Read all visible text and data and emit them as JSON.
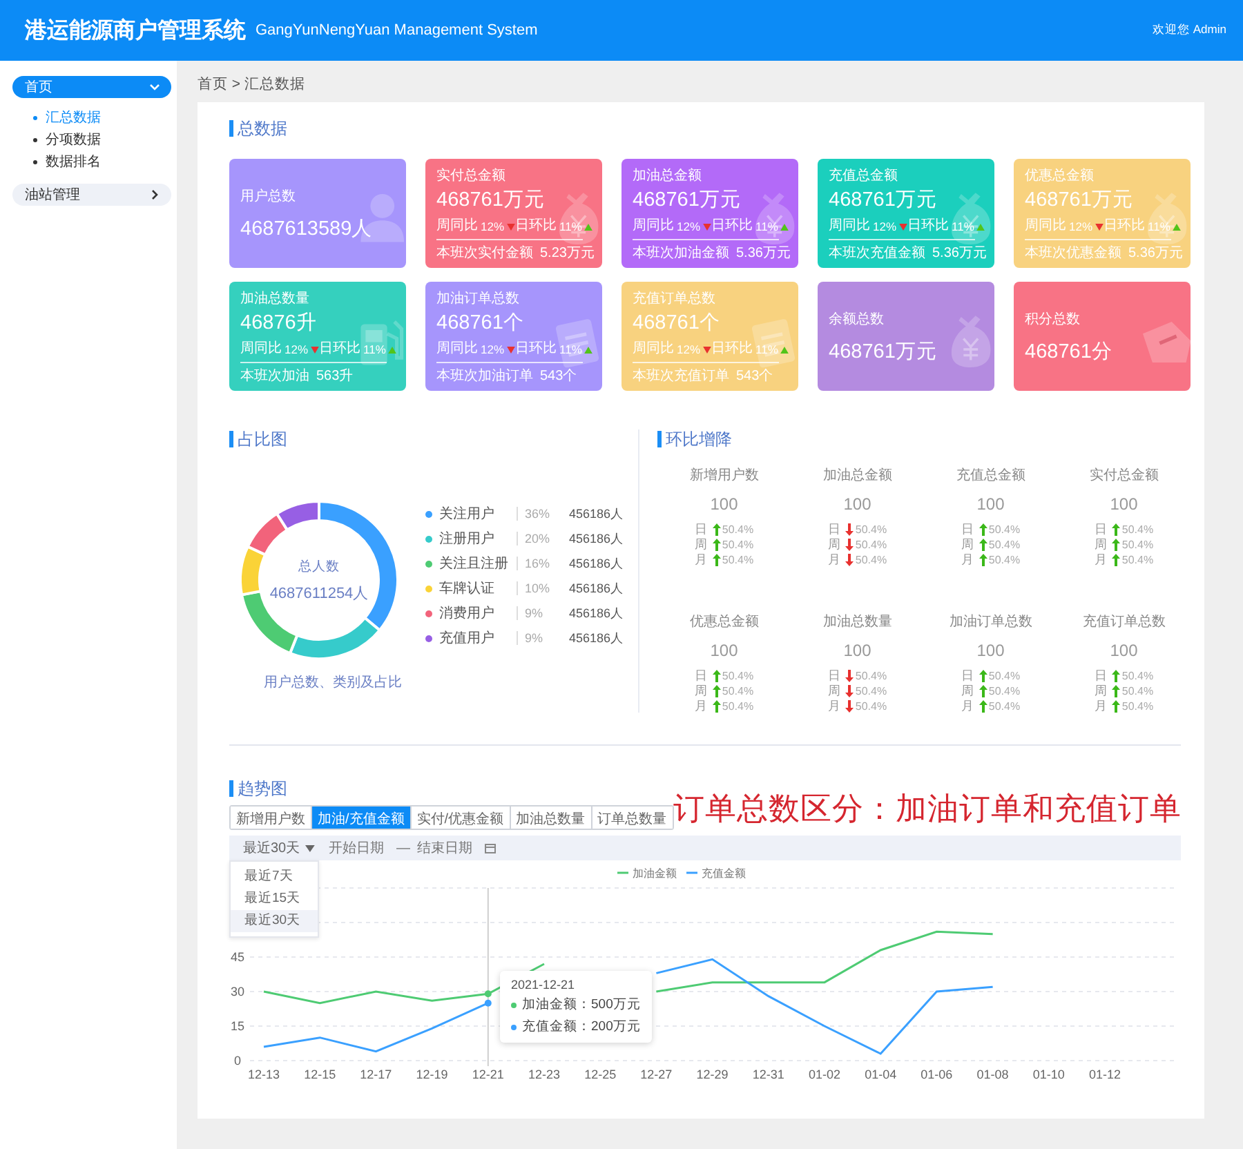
{
  "header": {
    "title": "港运能源商户管理系统",
    "subtitle": "GangYunNengYuan Management System",
    "welcome": "欢迎您 Admin"
  },
  "sidebar": {
    "items": [
      {
        "label": "首页",
        "expanded": true,
        "children": [
          {
            "label": "汇总数据",
            "selected": true
          },
          {
            "label": "分项数据",
            "selected": false
          },
          {
            "label": "数据排名",
            "selected": false
          }
        ]
      },
      {
        "label": "油站管理",
        "expanded": false
      }
    ]
  },
  "breadcrumb": "首页 > 汇总数据",
  "total_data": {
    "title": "总数据",
    "cards": [
      {
        "kind": "user",
        "title": "用户总数",
        "value": "4687613589人",
        "color": "#a695fc"
      },
      {
        "kind": "money",
        "title": "实付总金额",
        "value": "468761万元",
        "color": "#f87385",
        "stats": [
          {
            "label": "周同比",
            "value": "12%",
            "rising": false
          },
          {
            "label": "日环比",
            "value": "11%",
            "rising": true
          }
        ],
        "footer_label": "本班次实付金额",
        "footer_value": "5.23万元"
      },
      {
        "kind": "money",
        "title": "加油总金额",
        "value": "468761万元",
        "color": "#b36af8",
        "stats": [
          {
            "label": "周同比",
            "value": "12%",
            "rising": false
          },
          {
            "label": "日环比",
            "value": "11%",
            "rising": true
          }
        ],
        "footer_label": "本班次加油金额",
        "footer_value": "5.36万元"
      },
      {
        "kind": "money",
        "title": "充值总金额",
        "value": "468761万元",
        "color": "#1bcfbd",
        "stats": [
          {
            "label": "周同比",
            "value": "12%",
            "rising": false
          },
          {
            "label": "日环比",
            "value": "11%",
            "rising": true
          }
        ],
        "footer_label": "本班次充值金额",
        "footer_value": "5.36万元"
      },
      {
        "kind": "money",
        "title": "优惠总金额",
        "value": "468761万元",
        "color": "#f8d27f",
        "stats": [
          {
            "label": "周同比",
            "value": "12%",
            "rising": false
          },
          {
            "label": "日环比",
            "value": "11%",
            "rising": true
          }
        ],
        "footer_label": "本班次优惠金额",
        "footer_value": "5.36万元"
      },
      {
        "kind": "fuel",
        "title": "加油总数量",
        "value": "46876升",
        "color": "#35d0be",
        "stats": [
          {
            "label": "周同比",
            "value": "12%",
            "rising": false
          },
          {
            "label": "日环比",
            "value": "11%",
            "rising": true
          }
        ],
        "footer_label": "本班次加油",
        "footer_value": "563升"
      },
      {
        "kind": "order",
        "title": "加油订单总数",
        "value": "468761个",
        "color": "#a695fc",
        "stats": [
          {
            "label": "周同比",
            "value": "12%",
            "rising": false
          },
          {
            "label": "日环比",
            "value": "11%",
            "rising": true
          }
        ],
        "footer_label": "本班次加油订单",
        "footer_value": "543个"
      },
      {
        "kind": "order",
        "title": "充值订单总数",
        "value": "468761个",
        "color": "#f8d27f",
        "stats": [
          {
            "label": "周同比",
            "value": "12%",
            "rising": false
          },
          {
            "label": "日环比",
            "value": "11%",
            "rising": true
          }
        ],
        "footer_label": "本班次充值订单",
        "footer_value": "543个"
      },
      {
        "kind": "money",
        "title": "余额总数",
        "value": "468761万元",
        "color": "#b48be0"
      },
      {
        "kind": "points",
        "title": "积分总数",
        "value": "468761分",
        "color": "#f87385"
      }
    ]
  },
  "share": {
    "title": "占比图",
    "center_label": "总人数",
    "center_value": "4687611254人",
    "caption": "用户总数、类别及占比",
    "legend": [
      {
        "percent": "36%",
        "count": "456186人",
        "color": "#3aa0ff"
      },
      {
        "percent": "20%",
        "count": "456186人",
        "color": "#36cbcb"
      },
      {
        "percent": "16%",
        "count": "456186人",
        "color": "#4ecb73"
      },
      {
        "percent": "10%",
        "count": "456186人",
        "color": "#fad337"
      },
      {
        "percent": "9%",
        "count": "456186人",
        "color": "#f2637b"
      },
      {
        "percent": "9%",
        "count": "456186人",
        "color": "#975fe4"
      }
    ],
    "chart_data": {
      "type": "donut",
      "categories": [
        "关注用户",
        "注册用户",
        "关注且注册",
        "车牌认证",
        "消费用户",
        "充值用户"
      ],
      "values": [
        36,
        20,
        16,
        10,
        9,
        9
      ]
    }
  },
  "ratio": {
    "title": "环比增降",
    "items": [
      {
        "title": "新增用户数",
        "value": "100",
        "rows": [
          {
            "period": "日",
            "rising": true,
            "change": "50.4%"
          },
          {
            "period": "周",
            "rising": true,
            "change": "50.4%"
          },
          {
            "period": "月",
            "rising": true,
            "change": "50.4%"
          }
        ]
      },
      {
        "title": "加油总金额",
        "value": "100",
        "rows": [
          {
            "period": "日",
            "rising": false,
            "change": "50.4%"
          },
          {
            "period": "周",
            "rising": false,
            "change": "50.4%"
          },
          {
            "period": "月",
            "rising": false,
            "change": "50.4%"
          }
        ]
      },
      {
        "title": "充值总金额",
        "value": "100",
        "rows": [
          {
            "period": "日",
            "rising": true,
            "change": "50.4%"
          },
          {
            "period": "周",
            "rising": true,
            "change": "50.4%"
          },
          {
            "period": "月",
            "rising": true,
            "change": "50.4%"
          }
        ]
      },
      {
        "title": "实付总金额",
        "value": "100",
        "rows": [
          {
            "period": "日",
            "rising": true,
            "change": "50.4%"
          },
          {
            "period": "周",
            "rising": true,
            "change": "50.4%"
          },
          {
            "period": "月",
            "rising": true,
            "change": "50.4%"
          }
        ]
      },
      {
        "title": "优惠总金额",
        "value": "100",
        "rows": [
          {
            "period": "日",
            "rising": true,
            "change": "50.4%"
          },
          {
            "period": "周",
            "rising": true,
            "change": "50.4%"
          },
          {
            "period": "月",
            "rising": true,
            "change": "50.4%"
          }
        ]
      },
      {
        "title": "加油总数量",
        "value": "100",
        "rows": [
          {
            "period": "日",
            "rising": false,
            "change": "50.4%"
          },
          {
            "period": "周",
            "rising": false,
            "change": "50.4%"
          },
          {
            "period": "月",
            "rising": false,
            "change": "50.4%"
          }
        ]
      },
      {
        "title": "加油订单总数",
        "value": "100",
        "rows": [
          {
            "period": "日",
            "rising": true,
            "change": "50.4%"
          },
          {
            "period": "周",
            "rising": true,
            "change": "50.4%"
          },
          {
            "period": "月",
            "rising": true,
            "change": "50.4%"
          }
        ]
      },
      {
        "title": "充值订单总数",
        "value": "100",
        "rows": [
          {
            "period": "日",
            "rising": true,
            "change": "50.4%"
          },
          {
            "period": "周",
            "rising": true,
            "change": "50.4%"
          },
          {
            "period": "月",
            "rising": true,
            "change": "50.4%"
          }
        ]
      }
    ]
  },
  "trend": {
    "title": "趋势图",
    "tabs": [
      {
        "label": "新增用户数",
        "selected": false
      },
      {
        "label": "加油/充值金额",
        "selected": true
      },
      {
        "label": "实付/优惠金额",
        "selected": false
      },
      {
        "label": "加油总数量",
        "selected": false
      },
      {
        "label": "订单总数量",
        "selected": false
      }
    ],
    "note": "订单总数区分：加油订单和充值订单",
    "range_select": {
      "value": "最近30天",
      "expanded": true
    },
    "range_options": [
      {
        "label": "最近7天",
        "selected": false
      },
      {
        "label": "最近15天",
        "selected": false
      },
      {
        "label": "最近30天",
        "selected": true
      }
    ],
    "date_range": {
      "start_placeholder": "开始日期",
      "separator": "—",
      "end_placeholder": "结束日期"
    },
    "tooltip": {
      "title": "2021-12-21",
      "rows": [
        "加油金额：500万元",
        "充值金额：200万元"
      ]
    },
    "chart_data": {
      "type": "line",
      "categories": [
        "12-13",
        "12-15",
        "12-17",
        "12-19",
        "12-21",
        "12-23",
        "12-25",
        "12-27",
        "12-29",
        "12-31",
        "01-02",
        "01-04",
        "01-06",
        "01-08",
        "01-10",
        "01-12"
      ],
      "series": [
        {
          "name": "加油金额",
          "color": "#4ecb73",
          "values": [
            30,
            25,
            30,
            26,
            29,
            42,
            null,
            30,
            34,
            34,
            34,
            48,
            56,
            55,
            null,
            null
          ]
        },
        {
          "name": "充值金额",
          "color": "#3aa0ff",
          "values": [
            6,
            10,
            4,
            14,
            25,
            null,
            null,
            38,
            44,
            28,
            15,
            3,
            30,
            32,
            null,
            null
          ]
        }
      ],
      "ylim": [
        0,
        75
      ],
      "yticks": [
        0,
        15,
        30,
        45
      ],
      "grid": true,
      "legend": "top",
      "ref_lines": [
        {
          "axis": "x",
          "value": "12-21"
        }
      ]
    }
  }
}
